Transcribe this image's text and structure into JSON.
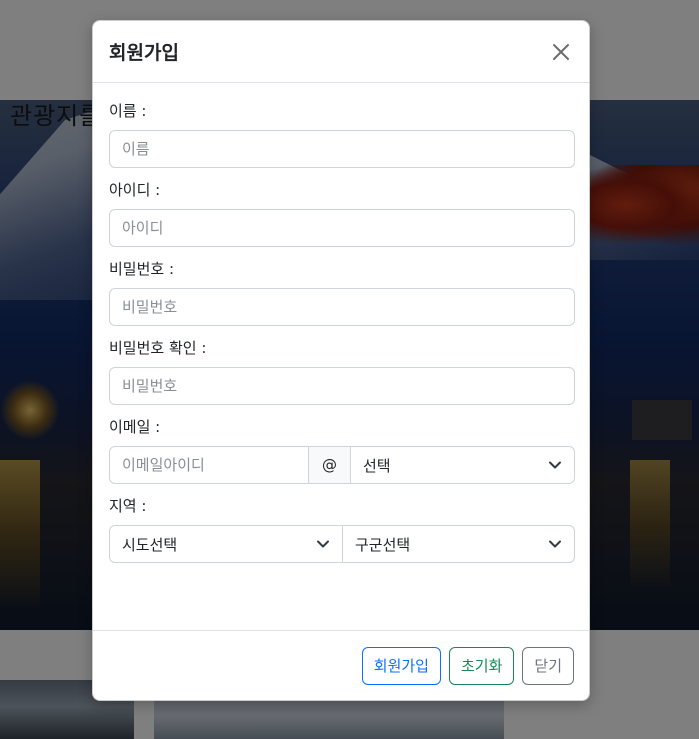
{
  "background": {
    "heading": "관광지를"
  },
  "modal": {
    "title": "회원가입",
    "close_icon": "close-icon",
    "fields": {
      "name": {
        "label": "이름 :",
        "placeholder": "이름"
      },
      "userid": {
        "label": "아이디 :",
        "placeholder": "아이디"
      },
      "password": {
        "label": "비밀번호 :",
        "placeholder": "비밀번호"
      },
      "password_confirm": {
        "label": "비밀번호 확인 :",
        "placeholder": "비밀번호"
      },
      "email": {
        "label": "이메일 :",
        "placeholder": "이메일아이디",
        "at": "@",
        "domain_selected": "선택"
      },
      "region": {
        "label": "지역 :",
        "sido_selected": "시도선택",
        "gugun_selected": "구군선택"
      }
    },
    "footer": {
      "signup_label": "회원가입",
      "reset_label": "초기화",
      "close_label": "닫기"
    }
  },
  "colors": {
    "primary": "#0d6efd",
    "success": "#198754",
    "secondary": "#6c757d",
    "backdrop": "rgba(0,0,0,0.5)"
  }
}
